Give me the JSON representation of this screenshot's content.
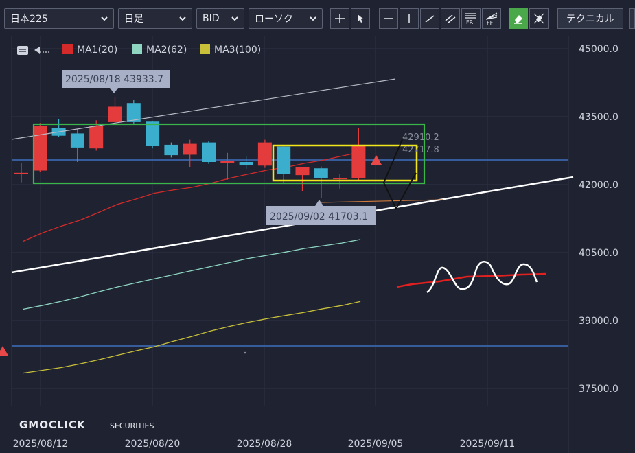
{
  "toolbar": {
    "symbol": "日本225",
    "timeframe": "日足",
    "price_side": "BID",
    "chart_type": "ローソク",
    "technical_label": "テクニカル",
    "tool_fr": "FR",
    "tool_ff": "FF"
  },
  "legend": {
    "ma1": "MA1(20)",
    "ma2": "MA2(62)",
    "ma3": "MA3(100)"
  },
  "colors": {
    "up": "#e43c3c",
    "down": "#3aaecc",
    "ma1": "#d42a2a",
    "ma2": "#8ed6c2",
    "ma3": "#c9c03a",
    "green_box": "#39b54a",
    "yellow_box": "#f3e61a"
  },
  "tooltips": {
    "high": "2025/08/18 43933.7",
    "low": "2025/09/02 41703.1"
  },
  "price_labels": {
    "upper": "42910.2",
    "lower": "42717.8"
  },
  "brand": {
    "name": "GMOCLICK",
    "sub": "SECURITIES"
  },
  "chart_data": {
    "type": "candlestick",
    "y_ticks": [
      "45000.0",
      "43500.0",
      "42000.0",
      "40500.0",
      "39000.0",
      "37500.0"
    ],
    "x_ticks": [
      "2025/08/12",
      "2025/08/20",
      "2025/08/28",
      "2025/09/05",
      "2025/09/11"
    ],
    "ylim": [
      37000,
      45100
    ],
    "candles": [
      {
        "o": 42230,
        "h": 42480,
        "l": 42050,
        "c": 42260
      },
      {
        "o": 42310,
        "h": 43360,
        "l": 42280,
        "c": 43300
      },
      {
        "o": 43250,
        "h": 43450,
        "l": 43050,
        "c": 43080
      },
      {
        "o": 43130,
        "h": 43220,
        "l": 42500,
        "c": 42820
      },
      {
        "o": 42800,
        "h": 43420,
        "l": 42750,
        "c": 43300
      },
      {
        "o": 43380,
        "h": 43934,
        "l": 43320,
        "c": 43720
      },
      {
        "o": 43800,
        "h": 43870,
        "l": 43350,
        "c": 43380
      },
      {
        "o": 43390,
        "h": 43400,
        "l": 42800,
        "c": 42850
      },
      {
        "o": 42880,
        "h": 42930,
        "l": 42600,
        "c": 42650
      },
      {
        "o": 42660,
        "h": 42990,
        "l": 42380,
        "c": 42900
      },
      {
        "o": 42930,
        "h": 42970,
        "l": 42460,
        "c": 42500
      },
      {
        "o": 42480,
        "h": 42700,
        "l": 42110,
        "c": 42520
      },
      {
        "o": 42500,
        "h": 42630,
        "l": 42350,
        "c": 42430
      },
      {
        "o": 42420,
        "h": 42990,
        "l": 42370,
        "c": 42930
      },
      {
        "o": 42840,
        "h": 42860,
        "l": 42020,
        "c": 42240
      },
      {
        "o": 42210,
        "h": 42240,
        "l": 41850,
        "c": 42390
      },
      {
        "o": 42360,
        "h": 42400,
        "l": 41703,
        "c": 42150
      },
      {
        "o": 42120,
        "h": 42230,
        "l": 41900,
        "c": 42150
      },
      {
        "o": 42150,
        "h": 43250,
        "l": 42100,
        "c": 42880
      }
    ],
    "ma1_values": [
      40750,
      40930,
      41080,
      41210,
      41380,
      41560,
      41680,
      41810,
      41880,
      41940,
      42030,
      42140,
      42230,
      42320,
      42380,
      42470,
      42540,
      42630,
      42720
    ],
    "ma2_values": [
      39250,
      39330,
      39420,
      39520,
      39630,
      39740,
      39830,
      39920,
      40010,
      40100,
      40190,
      40280,
      40370,
      40440,
      40510,
      40590,
      40650,
      40710,
      40790
    ],
    "ma3_values": [
      37840,
      37900,
      37960,
      38040,
      38130,
      38230,
      38330,
      38420,
      38540,
      38650,
      38770,
      38870,
      38960,
      39040,
      39110,
      39180,
      39260,
      39330,
      39420
    ]
  }
}
